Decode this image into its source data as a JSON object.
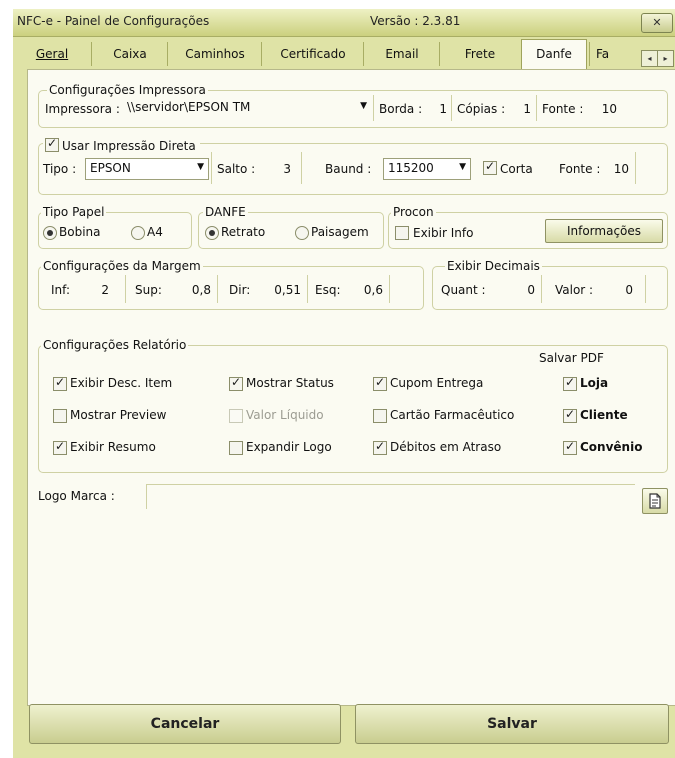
{
  "window": {
    "title": "NFC-e - Painel de Configurações",
    "version": "Versão : 2.3.81",
    "close_glyph": "✕"
  },
  "tabs": [
    {
      "label": "Geral"
    },
    {
      "label": "Caixa"
    },
    {
      "label": "Caminhos"
    },
    {
      "label": "Certificado"
    },
    {
      "label": "Email"
    },
    {
      "label": "Frete"
    },
    {
      "label": "Danfe"
    },
    {
      "label": "Fa"
    }
  ],
  "tab_scroll": {
    "left": "◂",
    "right": "▸"
  },
  "impressora": {
    "group_title": "Configurações Impressora",
    "printer_label": "Impressora :",
    "printer_value": "\\\\servidor\\EPSON TM",
    "borda_label": "Borda :",
    "borda_value": "1",
    "copias_label": "Cópias :",
    "copias_value": "1",
    "fonte_label": "Fonte :",
    "fonte_value": "10"
  },
  "direta": {
    "checkbox_label": "Usar Impressão Direta",
    "checked": true,
    "tipo_label": "Tipo :",
    "tipo_value": "EPSON",
    "salto_label": "Salto :",
    "salto_value": "3",
    "baund_label": "Baund :",
    "baund_value": "115200",
    "corta_label": "Corta",
    "corta_checked": true,
    "fonte_label": "Fonte :",
    "fonte_value": "10"
  },
  "tipo_papel": {
    "title": "Tipo Papel",
    "options": [
      "Bobina",
      "A4"
    ],
    "selected": "Bobina"
  },
  "danfe": {
    "title": "DANFE",
    "options": [
      "Retrato",
      "Paisagem"
    ],
    "selected": "Retrato"
  },
  "procon": {
    "title": "Procon",
    "exibir_label": "Exibir Info",
    "exibir_checked": false,
    "button_label": "Informações"
  },
  "margem": {
    "title": "Configurações da Margem",
    "inf_label": "Inf:",
    "inf_value": "2",
    "sup_label": "Sup:",
    "sup_value": "0,8",
    "dir_label": "Dir:",
    "dir_value": "0,51",
    "esq_label": "Esq:",
    "esq_value": "0,6"
  },
  "decimais": {
    "title": "Exibir Decimais",
    "quant_label": "Quant :",
    "quant_value": "0",
    "valor_label": "Valor :",
    "valor_value": "0"
  },
  "relatorio": {
    "title": "Configurações Relatório",
    "salvar_pdf_label": "Salvar PDF",
    "options": [
      {
        "label": "Exibir Desc. Item",
        "checked": true
      },
      {
        "label": "Mostrar Status",
        "checked": true
      },
      {
        "label": "Cupom Entrega",
        "checked": true
      },
      {
        "label": "Loja",
        "checked": true
      },
      {
        "label": "Mostrar Preview",
        "checked": false
      },
      {
        "label": "Valor Líquido",
        "checked": false,
        "disabled": true
      },
      {
        "label": "Cartão Farmacêutico",
        "checked": false
      },
      {
        "label": "Cliente",
        "checked": true
      },
      {
        "label": "Exibir Resumo",
        "checked": true
      },
      {
        "label": "Expandir Logo",
        "checked": false
      },
      {
        "label": "Débitos em Atraso",
        "checked": true
      },
      {
        "label": "Convênio",
        "checked": true
      }
    ]
  },
  "logo": {
    "label": "Logo Marca :",
    "value": ""
  },
  "buttons": {
    "cancel": "Cancelar",
    "save": "Salvar"
  }
}
